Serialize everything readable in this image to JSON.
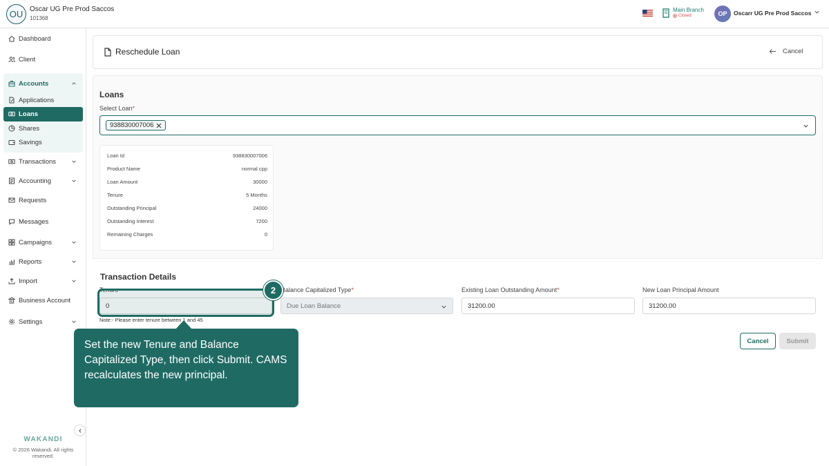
{
  "topbar": {
    "org_avatar": "OU",
    "org_name": "Oscar UG Pre Prod Saccos",
    "org_code": "101368",
    "branch_name": "Main Branch",
    "branch_status": "Closed",
    "user_initials": "OP",
    "user_name": "Oscarr UG Pre Prod Saccos"
  },
  "sidebar": {
    "items": {
      "dashboard": "Dashboard",
      "client": "Client",
      "accounts": "Accounts",
      "applications": "Applications",
      "loans": "Loans",
      "shares": "Shares",
      "savings": "Savings",
      "transactions": "Transactions",
      "accounting": "Accounting",
      "requests": "Requests",
      "messages": "Messages",
      "campaigns": "Campaigns",
      "reports": "Reports",
      "import": "Import",
      "business_account": "Business Account",
      "settings": "Settings"
    },
    "brand": "WAKANDI",
    "copyright": "© 2026 Wakandi. All rights reserved."
  },
  "header": {
    "title": "Reschedule Loan",
    "cancel_label": "Cancel"
  },
  "loans": {
    "section_title": "Loans",
    "select_label": "Select Loan",
    "selected_chip": "938830007006",
    "details": [
      {
        "key": "Loan Id",
        "value": "938830007006"
      },
      {
        "key": "Product Name",
        "value": "normal cpp"
      },
      {
        "key": "Loan Amount",
        "value": "30000"
      },
      {
        "key": "Tenure",
        "value": "5 Months"
      },
      {
        "key": "Outstanding Principal",
        "value": "24000"
      },
      {
        "key": "Outstanding Interest",
        "value": "7200"
      },
      {
        "key": "Remaining Charges",
        "value": "0"
      }
    ]
  },
  "transaction": {
    "section_title": "Transaction Details",
    "tenure_label": "Tenure",
    "tenure_value": "0",
    "balance_type_label": "Balance Capitalized Type",
    "balance_type_value": "Due Loan Balance",
    "existing_label": "Existing Loan Outstanding Amount",
    "existing_value": "31200.00",
    "new_principal_label": "New Loan Principal Amount",
    "new_principal_value": "31200.00",
    "note": "Note:- Please enter tenure between 1 and 45",
    "cancel_label": "Cancel",
    "submit_label": "Submit"
  },
  "tour": {
    "step": "2",
    "text": "Set the new Tenure and Balance Capitalized Type, then click Submit. CAMS recalculates the new principal."
  },
  "colors": {
    "accent": "#1f6b63",
    "required": "#d04848"
  }
}
